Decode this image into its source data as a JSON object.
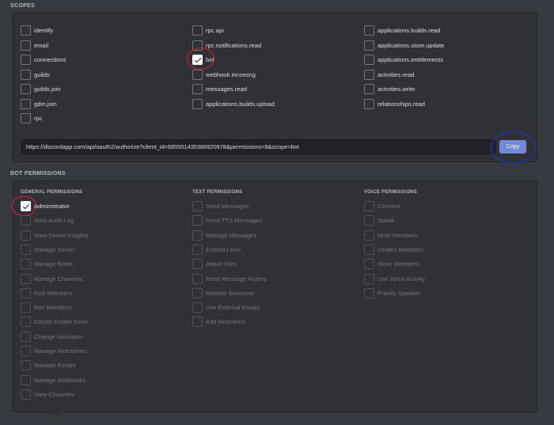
{
  "scopes": {
    "title": "SCOPES",
    "columns": [
      [
        {
          "label": "identify",
          "checked": false
        },
        {
          "label": "email",
          "checked": false
        },
        {
          "label": "connections",
          "checked": false
        },
        {
          "label": "guilds",
          "checked": false
        },
        {
          "label": "guilds.join",
          "checked": false
        },
        {
          "label": "gdm.join",
          "checked": false
        },
        {
          "label": "rpc",
          "checked": false
        }
      ],
      [
        {
          "label": "rpc.api",
          "checked": false
        },
        {
          "label": "rpc.notifications.read",
          "checked": false
        },
        {
          "label": "bot",
          "checked": true
        },
        {
          "label": "webhook.incoming",
          "checked": false
        },
        {
          "label": "messages.read",
          "checked": false
        },
        {
          "label": "applications.builds.upload",
          "checked": false
        }
      ],
      [
        {
          "label": "applications.builds.read",
          "checked": false
        },
        {
          "label": "applications.store.update",
          "checked": false
        },
        {
          "label": "applications.entitlements",
          "checked": false
        },
        {
          "label": "activities.read",
          "checked": false
        },
        {
          "label": "activities.write",
          "checked": false
        },
        {
          "label": "relationships.read",
          "checked": false
        }
      ]
    ],
    "url": "https://discordapp.com/api/oauth2/authorize?client_id=685501435386920978&permissions=8&scope=bot",
    "copy_label": "Copy"
  },
  "bot_permissions": {
    "title": "BOT PERMISSIONS",
    "columns": [
      {
        "heading": "GENERAL PERMISSIONS",
        "items": [
          {
            "label": "Administrator",
            "checked": true,
            "disabled": false
          },
          {
            "label": "View Audit Log",
            "checked": false,
            "disabled": true
          },
          {
            "label": "View Server Insights",
            "checked": false,
            "disabled": true
          },
          {
            "label": "Manage Server",
            "checked": false,
            "disabled": true
          },
          {
            "label": "Manage Roles",
            "checked": false,
            "disabled": true
          },
          {
            "label": "Manage Channels",
            "checked": false,
            "disabled": true
          },
          {
            "label": "Kick Members",
            "checked": false,
            "disabled": true
          },
          {
            "label": "Ban Members",
            "checked": false,
            "disabled": true
          },
          {
            "label": "Create Instant Invite",
            "checked": false,
            "disabled": true
          },
          {
            "label": "Change Nickname",
            "checked": false,
            "disabled": true
          },
          {
            "label": "Manage Nicknames",
            "checked": false,
            "disabled": true
          },
          {
            "label": "Manage Emojis",
            "checked": false,
            "disabled": true
          },
          {
            "label": "Manage Webhooks",
            "checked": false,
            "disabled": true
          },
          {
            "label": "View Channels",
            "checked": false,
            "disabled": true
          }
        ]
      },
      {
        "heading": "TEXT PERMISSIONS",
        "items": [
          {
            "label": "Send Messages",
            "checked": false,
            "disabled": true
          },
          {
            "label": "Send TTS Messages",
            "checked": false,
            "disabled": true
          },
          {
            "label": "Manage Messages",
            "checked": false,
            "disabled": true
          },
          {
            "label": "Embed Links",
            "checked": false,
            "disabled": true
          },
          {
            "label": "Attach Files",
            "checked": false,
            "disabled": true
          },
          {
            "label": "Read Message History",
            "checked": false,
            "disabled": true
          },
          {
            "label": "Mention Everyone",
            "checked": false,
            "disabled": true
          },
          {
            "label": "Use External Emojis",
            "checked": false,
            "disabled": true
          },
          {
            "label": "Add Reactions",
            "checked": false,
            "disabled": true
          }
        ]
      },
      {
        "heading": "VOICE PERMISSIONS",
        "items": [
          {
            "label": "Connect",
            "checked": false,
            "disabled": true
          },
          {
            "label": "Speak",
            "checked": false,
            "disabled": true
          },
          {
            "label": "Mute Members",
            "checked": false,
            "disabled": true
          },
          {
            "label": "Deafen Members",
            "checked": false,
            "disabled": true
          },
          {
            "label": "Move Members",
            "checked": false,
            "disabled": true
          },
          {
            "label": "Use Voice Activity",
            "checked": false,
            "disabled": true
          },
          {
            "label": "Priority Speaker",
            "checked": false,
            "disabled": true
          }
        ]
      }
    ]
  },
  "colors": {
    "background": "#36393f",
    "panel": "#2f3136",
    "accent": "#7289da",
    "annotation_red": "#e8202a",
    "annotation_blue": "#1d36e0"
  },
  "icons": {
    "checkbox_checked": "check-icon",
    "checkbox_unchecked": "empty-checkbox-icon"
  }
}
